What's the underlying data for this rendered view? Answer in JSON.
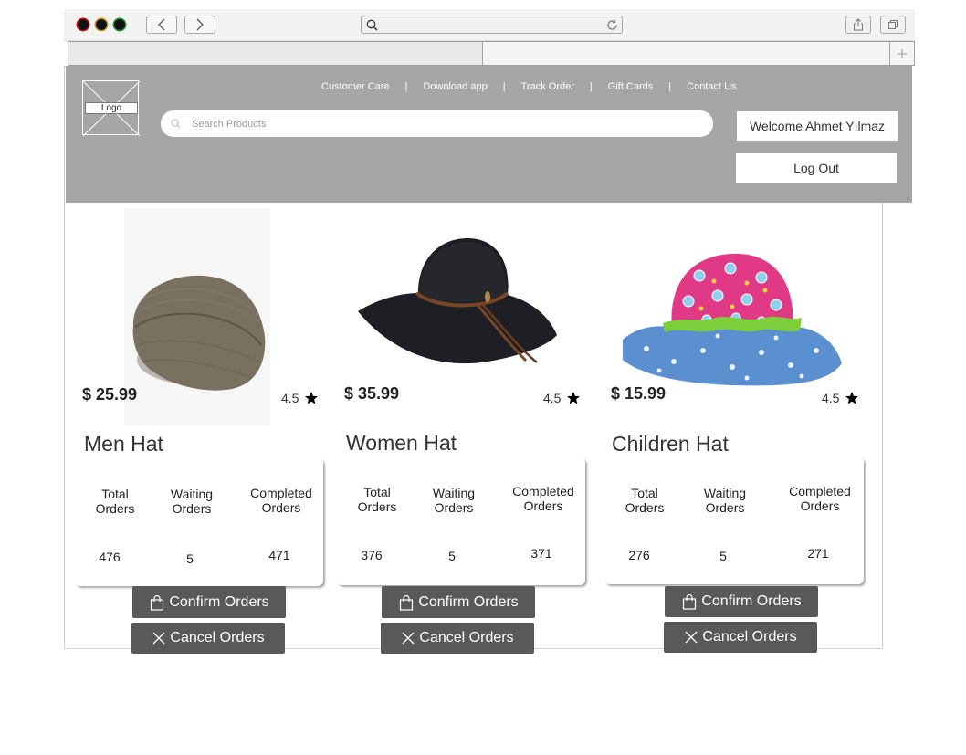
{
  "browser": {
    "traffic_lights": [
      "#000000",
      "#000000",
      "#000000"
    ],
    "traffic_light_rims": [
      "#d01010",
      "#c79a10",
      "#1f9a2a"
    ],
    "icons": [
      "back-icon",
      "forward-icon",
      "search-icon",
      "reload-icon",
      "share-icon",
      "tabs-icon",
      "plus-icon"
    ]
  },
  "header": {
    "logo_label": "Logo",
    "links": [
      "Customer Care",
      "Download app",
      "Track Order",
      "Gift Cards",
      "Contact Us"
    ],
    "search_placeholder": "Search Products",
    "welcome": "Welcome Ahmet Yılmaz",
    "logout": "Log Out",
    "background": "#a6a6a6"
  },
  "products": [
    {
      "name": "Men Hat",
      "price": "$ 25.99",
      "rating": "4.5",
      "stats": {
        "total_label": "Total Orders",
        "total": "476",
        "waiting_label": "Waiting Orders",
        "waiting": "5",
        "completed_label": "Completed Orders",
        "completed": "471"
      },
      "confirm": "Confirm Orders",
      "cancel": "Cancel Orders"
    },
    {
      "name": "Women Hat",
      "price": "$ 35.99",
      "rating": "4.5",
      "stats": {
        "total_label": "Total Orders",
        "total": "376",
        "waiting_label": "Waiting Orders",
        "waiting": "5",
        "completed_label": "Completed Orders",
        "completed": "371"
      },
      "confirm": "Confirm Orders",
      "cancel": "Cancel Orders"
    },
    {
      "name": "Children Hat",
      "price": "$ 15.99",
      "rating": "4.5",
      "stats": {
        "total_label": "Total Orders",
        "total": "276",
        "waiting_label": "Waiting Orders",
        "waiting": "5",
        "completed_label": "Completed Orders",
        "completed": "271"
      },
      "confirm": "Confirm Orders",
      "cancel": "Cancel Orders"
    }
  ],
  "colors": {
    "button": "#595959",
    "header": "#a6a6a6"
  }
}
